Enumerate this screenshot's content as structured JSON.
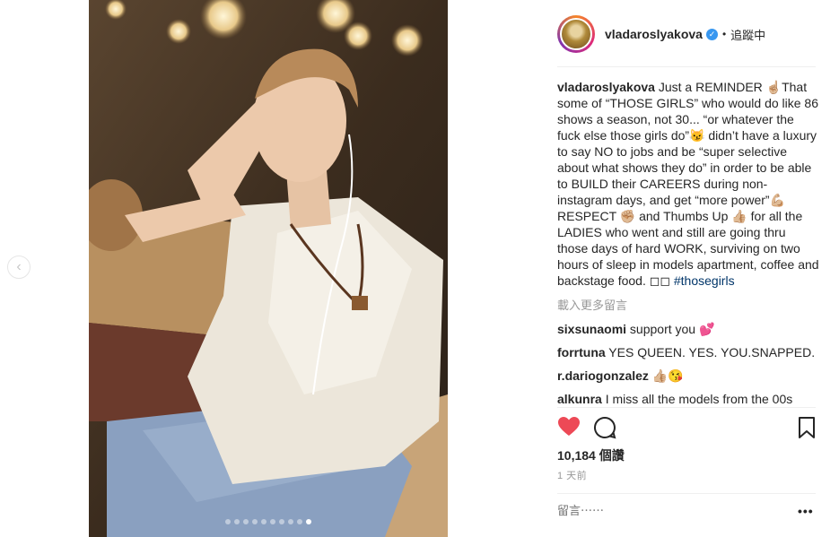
{
  "post": {
    "username": "vladaroslyakova",
    "follow_separator": "•",
    "follow_status": "追蹤中",
    "caption": {
      "username": "vladaroslyakova",
      "text": " Just a REMINDER ☝🏼That some of “THOSE GIRLS” who would do like 86 shows a season, not 30... “or whatever the fuck else those girls do”😼 didn’t have a luxury to say NO to jobs and be “super selective about what shows they do” in order to be able to BUILD their CAREERS during non-instagram days, and get “more power”💪🏼",
      "text2": "RESPECT ✊🏼 and Thumbs Up 👍🏼 for all the LADIES who went and still are going thru those days of hard WORK, surviving on two hours of sleep in models apartment, coffee and backstage food. ◻◻ ",
      "hashtag": "#thosegirls"
    },
    "load_more": "載入更多留言",
    "comments": [
      {
        "user": "sixsunaomi",
        "text": " support you 💕"
      },
      {
        "user": "forrtuna",
        "text": " YES QUEEN. YES. YOU.SNAPPED."
      },
      {
        "user": "r.dariogonzalez",
        "text": " 👍🏼😘"
      },
      {
        "user": "alkunra",
        "text": " I miss all the models from the 00s"
      }
    ],
    "likes": "10,184 個讚",
    "time": "1 天前",
    "comment_placeholder": "留言⋯⋯",
    "more_options": "•••"
  },
  "carousel": {
    "total": 10,
    "active_index": 9
  },
  "colors": {
    "like_red": "#ed4956",
    "verified_blue": "#3897f0",
    "hashtag": "#003569"
  },
  "icons": [
    "prev-arrow-icon",
    "verified-badge-icon",
    "heart-icon",
    "comment-icon",
    "bookmark-icon",
    "more-icon"
  ]
}
